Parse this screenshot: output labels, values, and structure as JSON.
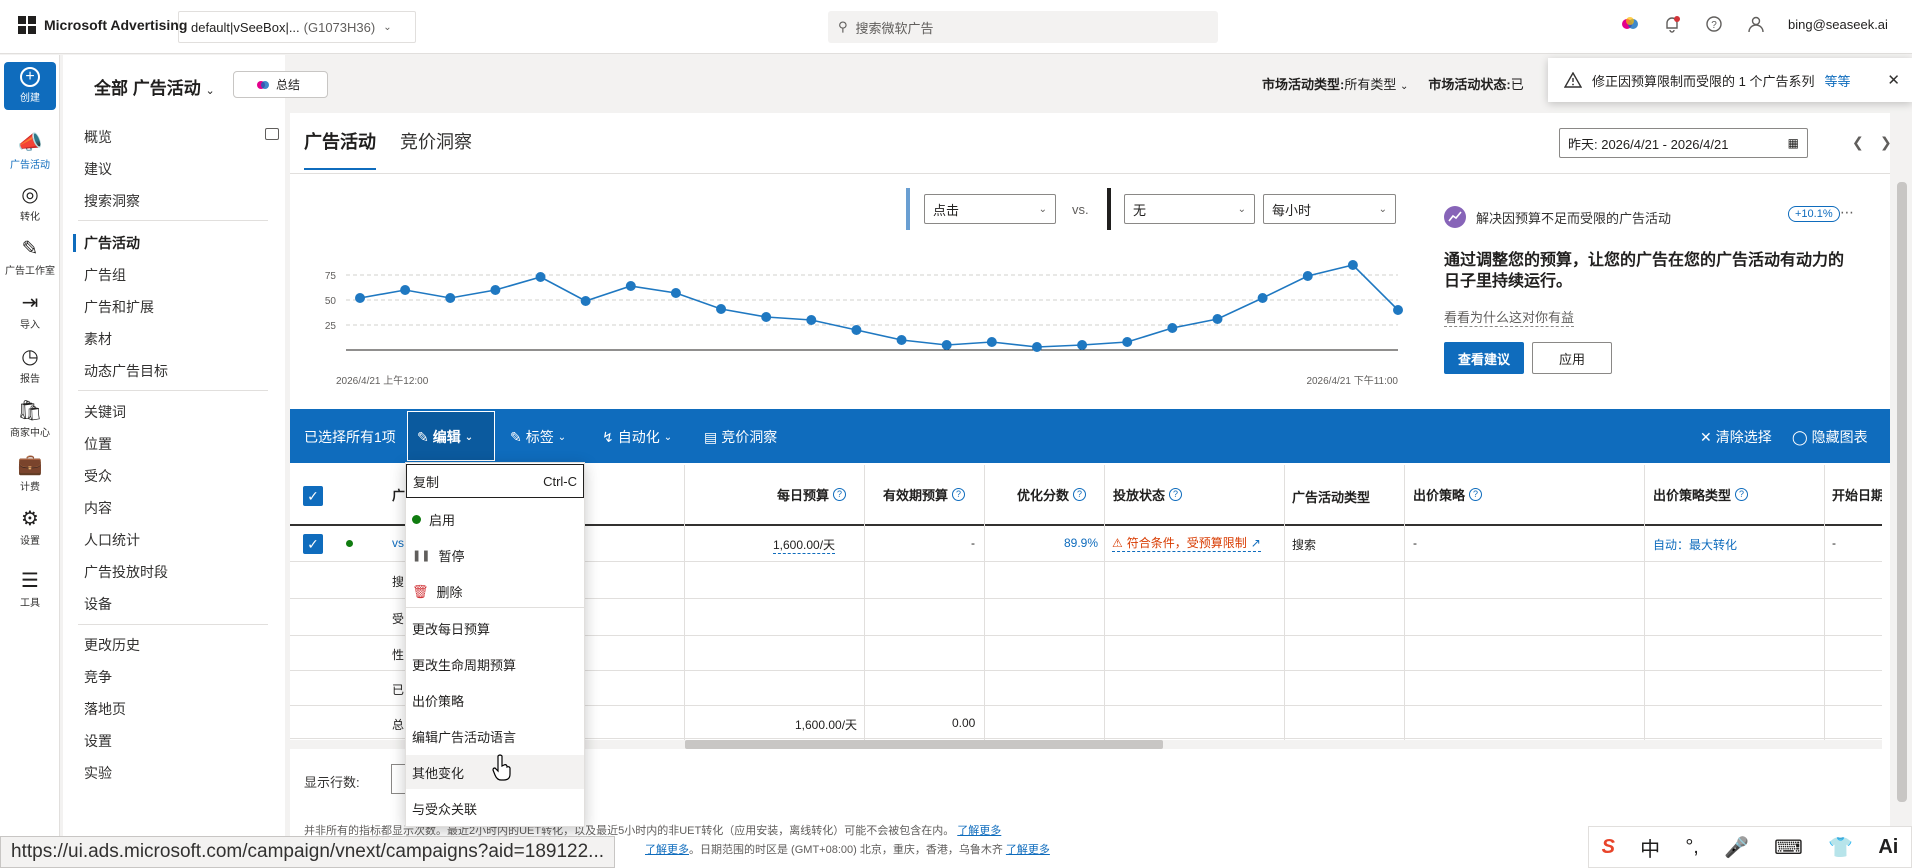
{
  "brand": {
    "name": "Microsoft Advertising"
  },
  "account": {
    "name": "default|vSeeBox|...",
    "id": "(G1073H36)"
  },
  "search": {
    "placeholder": "搜索微软广告"
  },
  "user": {
    "email": "bing@seaseek.ai"
  },
  "rail": {
    "create": "创建",
    "items": [
      "广告活动",
      "转化",
      "广告工作室",
      "导入",
      "报告",
      "商家中心",
      "计费",
      "设置",
      "工具"
    ]
  },
  "nav": {
    "header": "全部 广告活动",
    "summary": "总结",
    "items": [
      "概览",
      "建议",
      "搜索洞察",
      "广告活动",
      "广告组",
      "广告和扩展",
      "素材",
      "动态广告目标",
      "关键词",
      "位置",
      "受众",
      "内容",
      "人口统计",
      "广告投放时段",
      "设备",
      "更改历史",
      "竞争",
      "落地页",
      "设置",
      "实验"
    ]
  },
  "filters": {
    "type_label": "市场活动类型:",
    "type_value": "所有类型",
    "status_label": "市场活动状态:",
    "status_value": "已"
  },
  "toast": {
    "text": "修正因预算限制而受限的 1 个广告系列",
    "link": "等等"
  },
  "tabs": [
    "广告活动",
    "竞价洞察"
  ],
  "date_range": "昨天: 2026/4/21 - 2026/4/21",
  "chart_controls": {
    "metric1": "点击",
    "vs": "vs.",
    "metric2": "无",
    "granularity": "每小时"
  },
  "chart_data": {
    "type": "line",
    "title": "",
    "xlabel": "",
    "ylabel": "",
    "ylim": [
      0,
      100
    ],
    "yticks": [
      25,
      50,
      75
    ],
    "x_start_label": "2026/4/21 上午12:00",
    "x_end_label": "2026/4/21 下午11:00",
    "x": [
      0,
      1,
      2,
      3,
      4,
      5,
      6,
      7,
      8,
      9,
      10,
      11,
      12,
      13,
      14,
      15,
      16,
      17,
      18,
      19,
      20,
      21,
      22,
      23
    ],
    "series": [
      {
        "color": "#1f78c1",
        "values": [
          52,
          60,
          52,
          60,
          73,
          49,
          64,
          57,
          41,
          33,
          30,
          20,
          10,
          5,
          8,
          3,
          5,
          8,
          22,
          31,
          52,
          74,
          85,
          40
        ]
      }
    ]
  },
  "insight": {
    "header": "解决因预算不足而受限的广告活动",
    "badge": "+10.1%",
    "title": "通过调整您的预算，让您的广告在您的广告活动有动力的日子里持续运行。",
    "link": "看看为什么这对你有益",
    "primary": "查看建议",
    "secondary": "应用"
  },
  "toolbar": {
    "selected": "已选择所有1项",
    "edit": "编辑",
    "labels": "标签",
    "automate": "自动化",
    "auction": "竞价洞察",
    "clear": "清除选择",
    "hide_chart": "隐藏图表"
  },
  "grid": {
    "columns": [
      "广",
      "每日预算",
      "有效期预算",
      "优化分数",
      "投放状态",
      "广告活动类型",
      "出价策略",
      "出价策略类型",
      "开始日期"
    ],
    "row": {
      "name": "vs",
      "daily_budget": "1,600.00/天",
      "lifetime_budget": "-",
      "opt_score": "89.9%",
      "status": "符合条件，受预算限制",
      "type": "搜索",
      "bid_strategy": "-",
      "bid_type": "自动：最大转化",
      "start": "-"
    },
    "sub_rows": [
      "搜",
      "受",
      "性",
      "已",
      "总"
    ],
    "total_daily": "1,600.00/天",
    "total_lifetime": "0.00"
  },
  "menu": {
    "copy": "复制",
    "copy_shortcut": "Ctrl-C",
    "items": [
      "启用",
      "暂停",
      "删除",
      "更改每日预算",
      "更改生命周期预算",
      "出价策略",
      "编辑广告活动语言",
      "其他变化",
      "与受众关联"
    ]
  },
  "bottom": {
    "rows_label": "显示行数:",
    "note1": "并非所有的指标都显示次数。最近2小时内的UET转化，以及最近5小时内的非UET转化（应用安装，离线转化）可能不会被包含在内。",
    "note1_link": "了解更多",
    "note2_link1": "了解更多",
    "note2": "。日期范围的时区是 (GMT+08:00) 北京，重庆，香港，乌鲁木齐",
    "note2_link2": "了解更多",
    "status_url": "https://ui.ads.microsoft.com/campaign/vnext/campaigns?aid=189122..."
  },
  "ime": {
    "items": [
      "S",
      "中",
      "°,",
      "🎤",
      "⌨",
      "👕",
      "Ai"
    ]
  }
}
